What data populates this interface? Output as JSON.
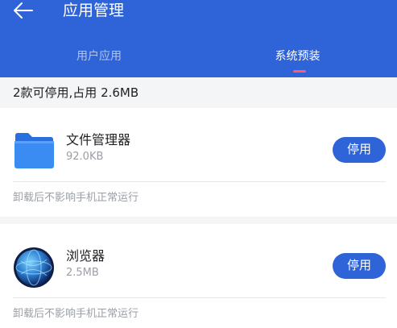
{
  "header": {
    "title": "应用管理",
    "back_icon": "arrow-left-icon",
    "background": "#2f63d8"
  },
  "tabs": [
    {
      "label": "用户应用",
      "active": false
    },
    {
      "label": "系统预装",
      "active": true
    }
  ],
  "summary": "2款可停用,占用 2.6MB",
  "apps": [
    {
      "name": "文件管理器",
      "size": "92.0KB",
      "icon": "folder-icon",
      "button": "停用",
      "note": "卸载后不影响手机正常运行"
    },
    {
      "name": "浏览器",
      "size": "2.5MB",
      "icon": "globe-icon",
      "button": "停用",
      "note": "卸载后不影响手机正常运行"
    }
  ],
  "colors": {
    "accent": "#2f63d8",
    "tab_indicator": "#ff5a6e"
  }
}
